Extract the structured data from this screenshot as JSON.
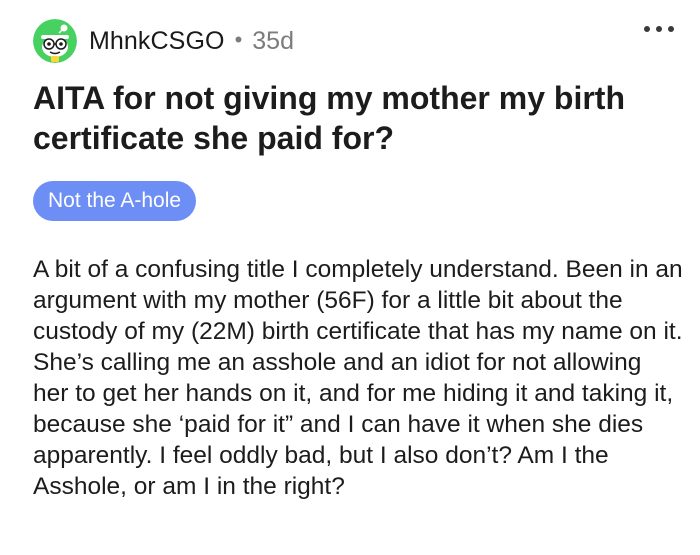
{
  "post": {
    "username": "MhnkCSGO",
    "separator": "•",
    "age": "35d",
    "avatar_icon": "snoo-avatar-icon",
    "more_icon": "more-options-icon",
    "title": "AITA for not giving my mother my birth certificate she paid for?",
    "flair": "Not the A-hole",
    "body": "A bit of a confusing title I completely understand. Been in an argument with my mother (56F) for a little bit about the custody of my (22M) birth certificate that has my name on it. She’s calling me an asshole and an idiot for not allowing her to get her hands on it, and for me hiding it and taking it, because she ‘paid for it” and I can have it when she dies apparently. I feel oddly bad, but I also don’t? Am I the Asshole, or am I in the right?"
  },
  "colors": {
    "flair_bg": "#6c8ef5",
    "avatar_bg": "#46d160",
    "meta_text": "#7c7c7c"
  }
}
